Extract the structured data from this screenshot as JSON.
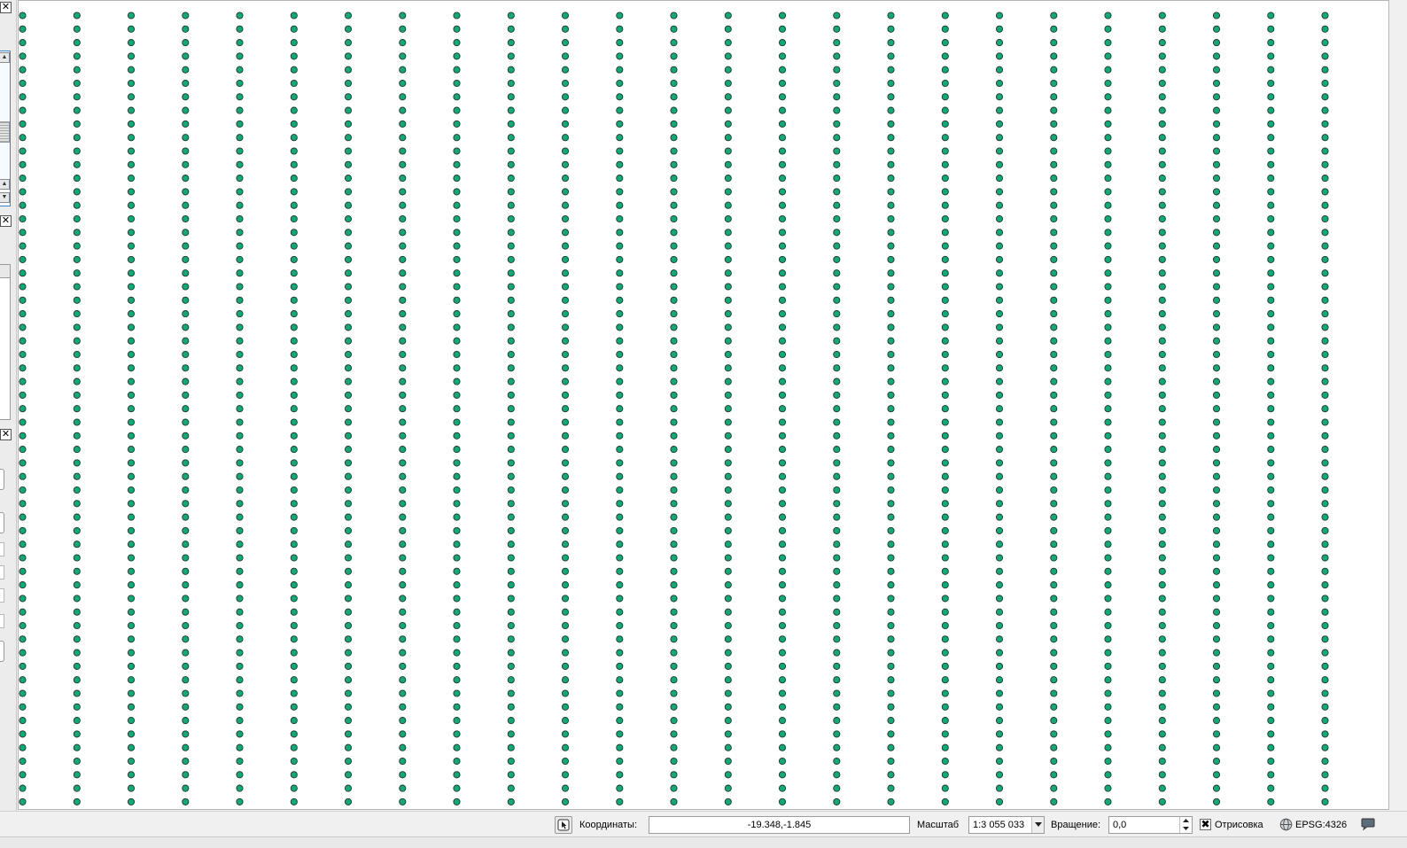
{
  "left_panels": {
    "close_glyph": "✕",
    "scroll_up_glyph": "▲",
    "scroll_down_glyph": "▼"
  },
  "map": {
    "layer_name": "",
    "background": "#ffffff",
    "point_fill": "#16a67a",
    "point_stroke": "#1a3a2a",
    "grid_columns": 25,
    "grid_rows": 59
  },
  "status_bar": {
    "coordinates_label": "Координаты:",
    "coordinates_value": "-19.348,-1.845",
    "scale_label": "Масштаб",
    "scale_value": "1:3 055 033",
    "rotation_label": "Вращение:",
    "rotation_value": "0,0",
    "render_checked": true,
    "render_check_glyph": "✖",
    "render_label": "Отрисовка",
    "crs_label": "EPSG:4326",
    "icons": [
      "mouse-toggle-icon",
      "globe-crs-icon",
      "messages-icon"
    ]
  }
}
